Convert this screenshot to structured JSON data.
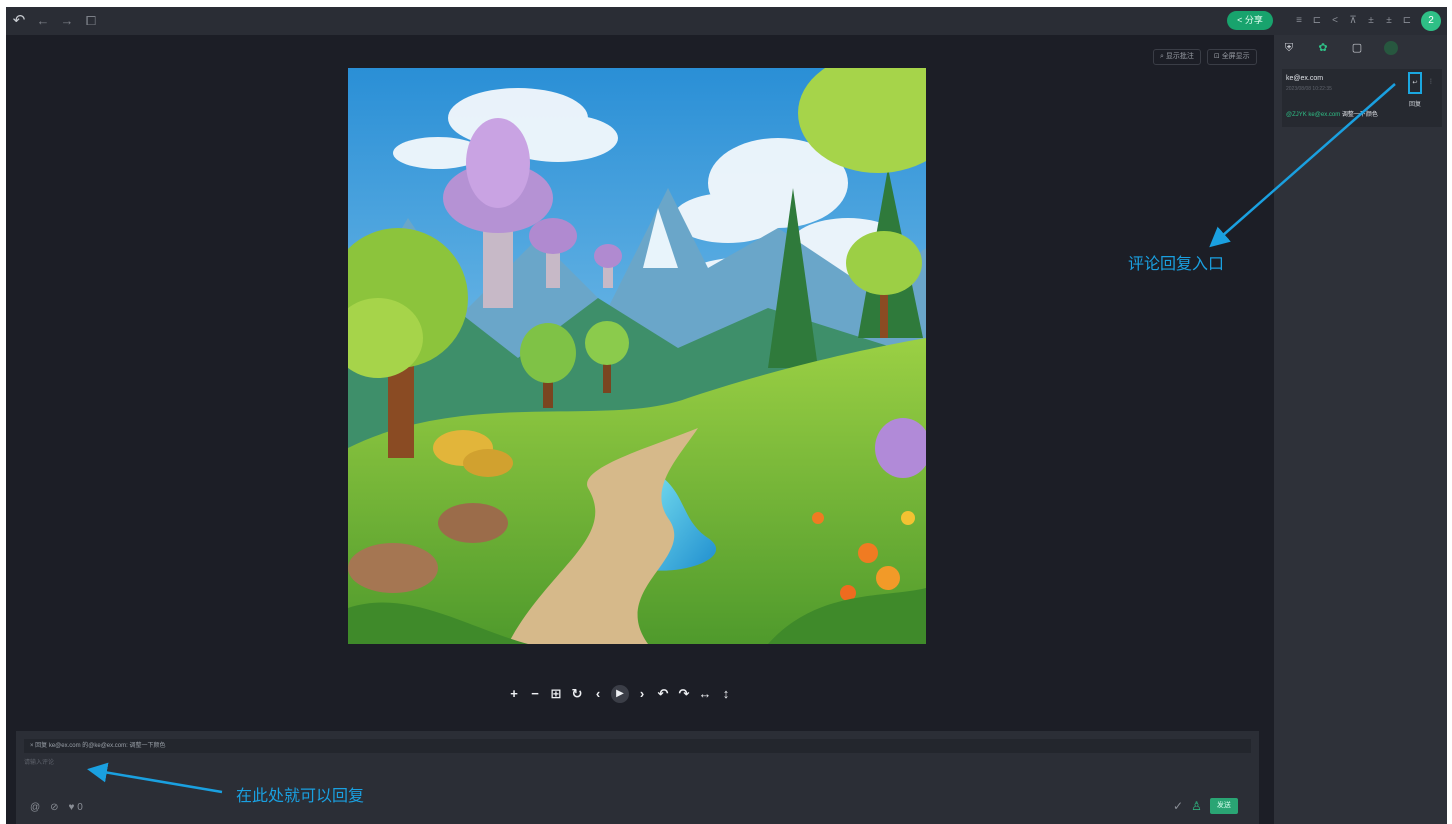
{
  "toolbar": {
    "left_icons": [
      "undo-icon",
      "back-icon",
      "forward-icon",
      "frame-icon"
    ],
    "share_label": "< 分享",
    "right_icons": [
      "tool-a-icon",
      "tool-b-icon",
      "tool-c-icon",
      "tool-d-icon",
      "tool-e-icon",
      "tool-f-icon",
      "tool-g-icon",
      "tool-h-icon"
    ],
    "avatar_initial": "2"
  },
  "view": {
    "show_comments_label": "显示批注",
    "view_mode_label": "全屏显示"
  },
  "player_controls": [
    "+",
    "−",
    "⊞",
    "↻",
    "‹",
    "▶",
    "›",
    "↶",
    "↷",
    "↔",
    "↕"
  ],
  "reply": {
    "quote_text": "× 回复 ke@ex.com 的@ke@ex.com: 调整一下颜色",
    "placeholder": "请输入评论",
    "tools": [
      "@",
      "⊘",
      "♥ 0"
    ],
    "send_label": "发送"
  },
  "sidebar": {
    "tabs": [
      "shield-icon",
      "leaf-icon",
      "box-icon",
      "dot-icon"
    ],
    "comment": {
      "author": "ke@ex.com",
      "meta": "2023/08/08 10:22:35",
      "reply_label": "回复",
      "mention": "@ZJYK ke@ex.com",
      "body": "调整一下颜色"
    }
  },
  "annotations": {
    "reply_entry": "评论回复入口",
    "reply_here": "在此处就可以回复"
  },
  "colors": {
    "accent": "#18a36d",
    "annotation": "#1aa0e0",
    "background": "#1c1e26"
  }
}
